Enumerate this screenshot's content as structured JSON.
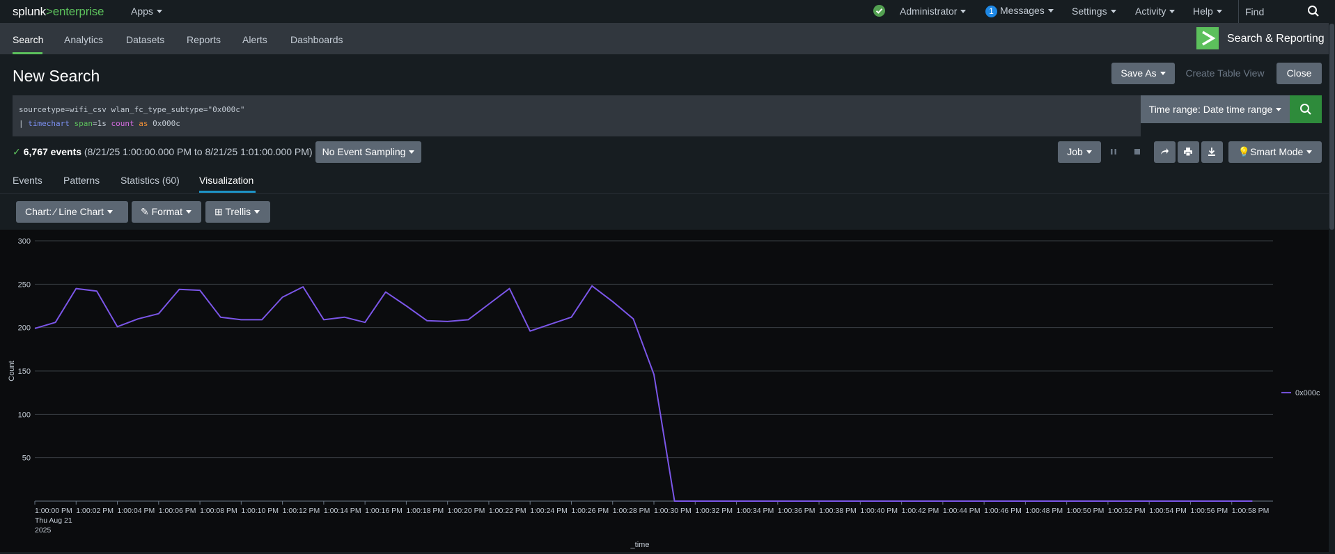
{
  "topbar": {
    "logo_main": "splunk",
    "logo_sep": ">",
    "logo_sub": "enterprise",
    "apps": "Apps",
    "user": "Administrator",
    "messages_count": "1",
    "messages": "Messages",
    "settings": "Settings",
    "activity": "Activity",
    "help": "Help",
    "find_placeholder": "Find"
  },
  "nav": {
    "items": [
      "Search",
      "Analytics",
      "Datasets",
      "Reports",
      "Alerts",
      "Dashboards"
    ],
    "app_title": "Search & Reporting"
  },
  "header": {
    "title": "New Search",
    "save_as": "Save As",
    "create_table_view": "Create Table View",
    "close": "Close"
  },
  "search": {
    "line1": "sourcetype=wifi_csv wlan_fc_type_subtype=\"0x000c\"",
    "line2_pipe": "| ",
    "line2_cmd": "timechart",
    "line2_arg": "span",
    "line2_argval": "=1s ",
    "line2_fn": "count",
    "line2_as": "as",
    "line2_alias": " 0x000c",
    "time_range": "Time range: Date time range"
  },
  "status": {
    "events": "6,767 events",
    "range": "(8/21/25 1:00:00.000 PM to 8/21/25 1:01:00.000 PM)",
    "sampling": "No Event Sampling",
    "job": "Job",
    "mode": "Smart Mode"
  },
  "tabs": [
    "Events",
    "Patterns",
    "Statistics (60)",
    "Visualization"
  ],
  "toolbar": {
    "chart": "Chart: ",
    "chart_type": "Line Chart",
    "format": "Format",
    "trellis": "Trellis"
  },
  "colors": {
    "series": "#7b56e8",
    "accent_green": "#5cc05c",
    "tab_underline": "#1e93c6"
  },
  "chart_data": {
    "type": "line",
    "xlabel": "_time",
    "ylabel": "Count",
    "ylim": [
      0,
      300
    ],
    "yticks": [
      50,
      100,
      150,
      200,
      250,
      300
    ],
    "first_tick_extra": [
      "Thu Aug 21",
      "2025"
    ],
    "xtick_labels": [
      "1:00:00 PM",
      "1:00:02 PM",
      "1:00:04 PM",
      "1:00:06 PM",
      "1:00:08 PM",
      "1:00:10 PM",
      "1:00:12 PM",
      "1:00:14 PM",
      "1:00:16 PM",
      "1:00:18 PM",
      "1:00:20 PM",
      "1:00:22 PM",
      "1:00:24 PM",
      "1:00:26 PM",
      "1:00:28 PM",
      "1:00:30 PM",
      "1:00:32 PM",
      "1:00:34 PM",
      "1:00:36 PM",
      "1:00:38 PM",
      "1:00:40 PM",
      "1:00:42 PM",
      "1:00:44 PM",
      "1:00:46 PM",
      "1:00:48 PM",
      "1:00:50 PM",
      "1:00:52 PM",
      "1:00:54 PM",
      "1:00:56 PM",
      "1:00:58 PM"
    ],
    "x_seconds_range": [
      0,
      60
    ],
    "legend_position": "right",
    "series": [
      {
        "name": "0x000c",
        "values": [
          199,
          206,
          245,
          242,
          201,
          210,
          216,
          244,
          243,
          212,
          209,
          209,
          235,
          247,
          209,
          212,
          206,
          241,
          225,
          208,
          207,
          209,
          227,
          245,
          196,
          204,
          212,
          248,
          230,
          210,
          146,
          0,
          0,
          0,
          0,
          0,
          0,
          0,
          0,
          0,
          0,
          0,
          0,
          0,
          0,
          0,
          0,
          0,
          0,
          0,
          0,
          0,
          0,
          0,
          0,
          0,
          0,
          0,
          0,
          0
        ]
      }
    ],
    "grid": true
  }
}
